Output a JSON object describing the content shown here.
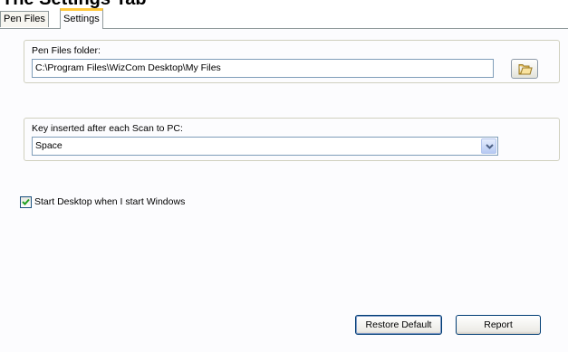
{
  "heading": "The Settings Tab",
  "tabs": [
    {
      "label": "Pen Files",
      "active": false
    },
    {
      "label": "Settings",
      "active": true
    }
  ],
  "pen_files_folder": {
    "label": "Pen Files folder:",
    "value": "C:\\Program Files\\WizCom Desktop\\My Files",
    "browse_icon": "folder-open-icon"
  },
  "key_after_scan": {
    "label": "Key inserted after each Scan to PC:",
    "selected": "Space",
    "dropdown_icon": "chevron-down-icon"
  },
  "startup": {
    "label": "Start Desktop when I start Windows",
    "checked": true
  },
  "buttons": {
    "restore_default": "Restore Default",
    "report": "Report"
  },
  "colors": {
    "active_tab_accent": "#ffc83c",
    "field_border": "#7f9db9",
    "button_border": "#003c74"
  }
}
